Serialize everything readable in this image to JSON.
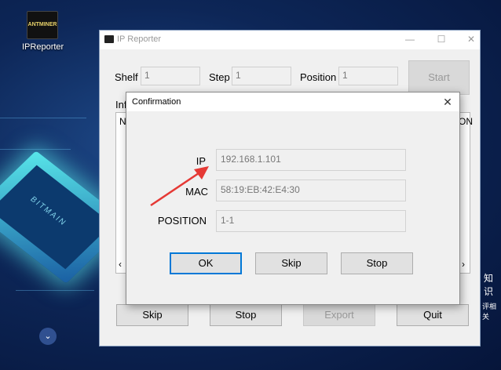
{
  "desktop": {
    "icon_label": "IPReporter",
    "icon_badge": "ANTMINER",
    "chip_text": "BITMAIN",
    "side_text_1": "知识",
    "side_text_2": "评相关"
  },
  "window": {
    "title": "IP Reporter",
    "controls": {
      "minimize": "—",
      "maximize": "☐",
      "close": "✕"
    },
    "fields": {
      "shelf_label": "Shelf",
      "shelf_value": "1",
      "step_label": "Step",
      "step_value": "1",
      "position_label": "Position",
      "position_value": "1"
    },
    "start_label": "Start",
    "info_label": "Info",
    "list_header_left": "N",
    "list_header_right": "ON",
    "scroll_left": "‹",
    "scroll_right": "›",
    "buttons": {
      "skip": "Skip",
      "stop": "Stop",
      "export": "Export",
      "quit": "Quit"
    }
  },
  "dialog": {
    "title": "Confirmation",
    "close": "✕",
    "ip_label": "IP",
    "ip_value": "192.168.1.101",
    "mac_label": "MAC",
    "mac_value": "58:19:EB:42:E4:30",
    "position_label": "POSITION",
    "position_value": "1-1",
    "ok": "OK",
    "skip": "Skip",
    "stop": "Stop"
  },
  "colors": {
    "annotation_arrow": "#e53935",
    "primary_focus": "#0078d7"
  }
}
